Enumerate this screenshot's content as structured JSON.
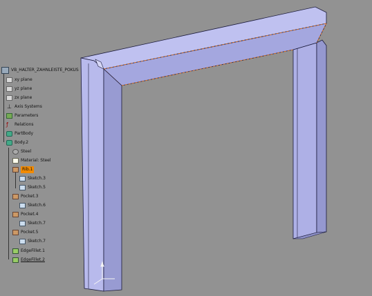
{
  "app": "CATIA Part Design",
  "viewport": {
    "background": "#929292",
    "part_color": "#b3b3ea",
    "edge_color": "#1a1a3a",
    "highlight_edge_color": "#e07020",
    "compass_axes": [
      "x-axis",
      "y-axis",
      "z-axis"
    ]
  },
  "tree": {
    "root": "VB_HALTER_ZAHNLEISTE_POKUS",
    "planes": [
      "xy plane",
      "yz plane",
      "zx plane"
    ],
    "axis_systems": "Axis Systems",
    "parameters": "Parameters",
    "relations": "Relations",
    "part_body": "PartBody",
    "body2": {
      "label": "Body.2",
      "material_ico": "Steel",
      "material": "Material: Steel",
      "rib": {
        "label": "Rib.1",
        "selected": true,
        "children": [
          "Sketch.3",
          "Sketch.5"
        ]
      },
      "pocket3": {
        "label": "Pocket.3",
        "children": [
          "Sketch.6"
        ]
      },
      "pocket4": {
        "label": "Pocket.4",
        "children": [
          "Sketch.7"
        ]
      },
      "pocket5": {
        "label": "Pocket.5",
        "children": [
          "Sketch.7"
        ]
      },
      "fillet1": "EdgeFillet.1",
      "fillet2": "EdgeFillet.2"
    },
    "highlight_color": "#f18a00"
  }
}
